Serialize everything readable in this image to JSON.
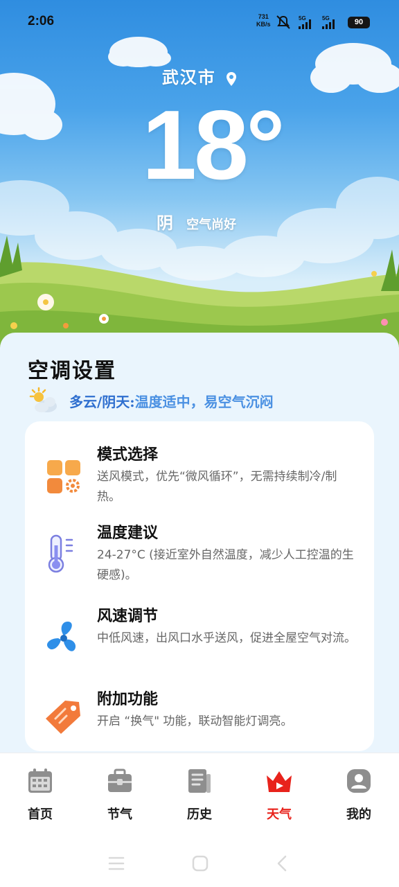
{
  "status_bar": {
    "time": "2:06",
    "net_speed_value": "731",
    "net_speed_unit": "KB/s",
    "signal_1": "5G",
    "signal_2": "5G",
    "battery": "90"
  },
  "hero": {
    "city": "武汉市",
    "temperature": "18°",
    "condition": "阴",
    "air_quality": "空气尚好"
  },
  "section": {
    "title": "空调设置",
    "weather_label": "多云/阴天:",
    "weather_desc": "温度适中，易空气沉闷"
  },
  "items": [
    {
      "title": "模式选择",
      "desc": "送风模式，优先“微风循环”，无需持续制冷/制热。",
      "icon": "grid-settings-icon"
    },
    {
      "title": "温度建议",
      "desc": "24-27°C (接近室外自然温度，减少人工控温的生硬感)。",
      "icon": "thermometer-icon"
    },
    {
      "title": "风速调节",
      "desc": "中低风速，出风口水乎送风，促进全屋空气对流。",
      "icon": "fan-icon"
    },
    {
      "title": "附加功能",
      "desc": "开启 “换气\" 功能，联动智能灯调亮。",
      "icon": "tag-icon"
    }
  ],
  "nav": [
    {
      "label": "首页",
      "icon": "calendar-icon"
    },
    {
      "label": "节气",
      "icon": "toolbox-icon"
    },
    {
      "label": "历史",
      "icon": "book-icon"
    },
    {
      "label": "天气",
      "icon": "crown-icon",
      "active": true
    },
    {
      "label": "我的",
      "icon": "user-icon"
    }
  ],
  "colors": {
    "accent_red": "#e8231c",
    "weather_label_blue": "#2f6fcf",
    "weather_desc_blue": "#4a90e2",
    "sky_blue": "#3f9be6"
  }
}
